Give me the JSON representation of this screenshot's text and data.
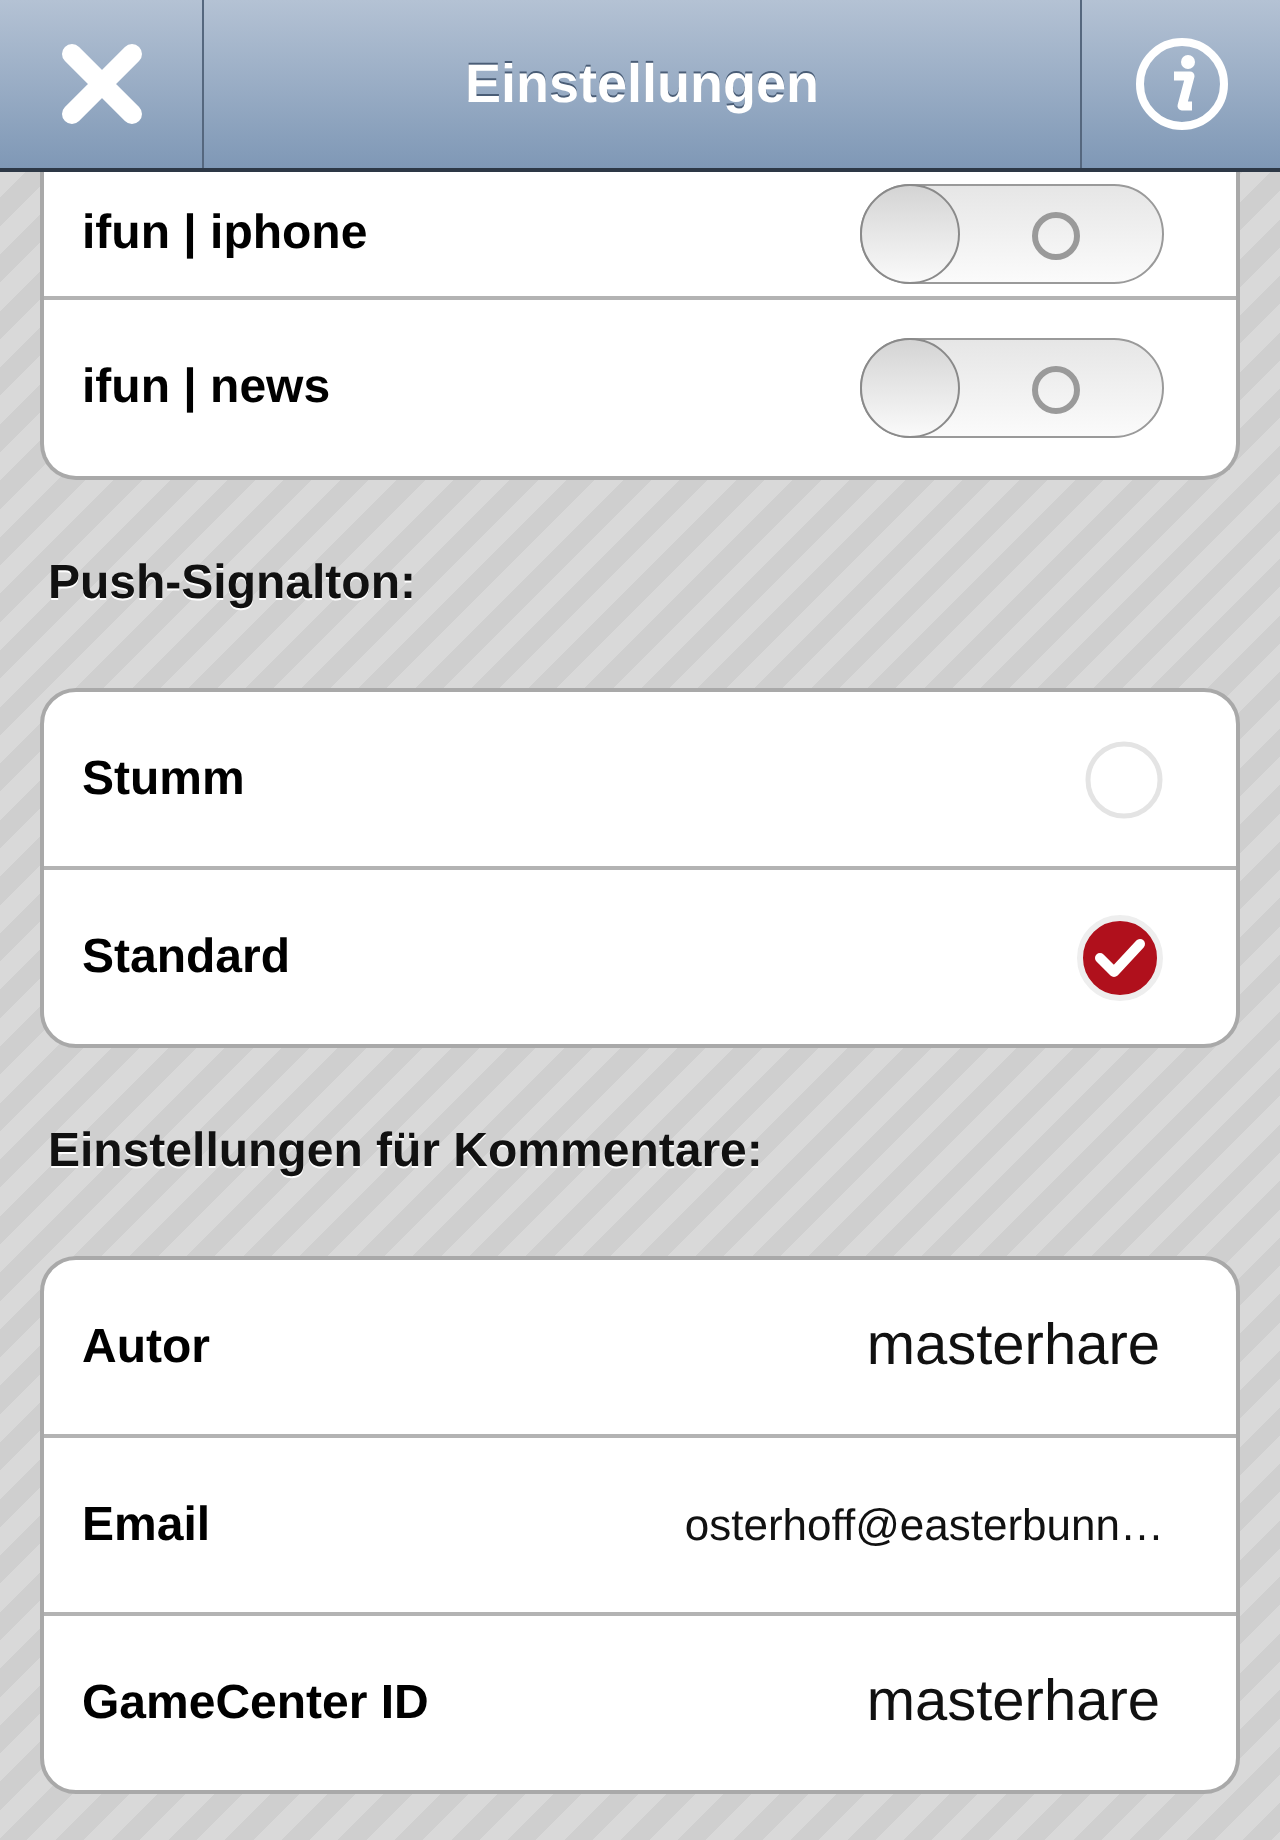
{
  "nav": {
    "title": "Einstellungen"
  },
  "push_channels": [
    {
      "label": "ifun | iphone",
      "on": false
    },
    {
      "label": "ifun | news",
      "on": false
    }
  ],
  "signal_header": "Push-Signalton:",
  "signal_options": [
    {
      "label": "Stumm",
      "selected": false
    },
    {
      "label": "Standard",
      "selected": true
    }
  ],
  "comments_header": "Einstellungen für Kommentare:",
  "comment_fields": [
    {
      "kind": "text",
      "label": "Autor",
      "value": "masterhare"
    },
    {
      "kind": "email",
      "label": "Email",
      "value": "osterhoff@easterbunn…"
    },
    {
      "kind": "text",
      "label": "GameCenter ID",
      "value": "masterhare"
    }
  ]
}
